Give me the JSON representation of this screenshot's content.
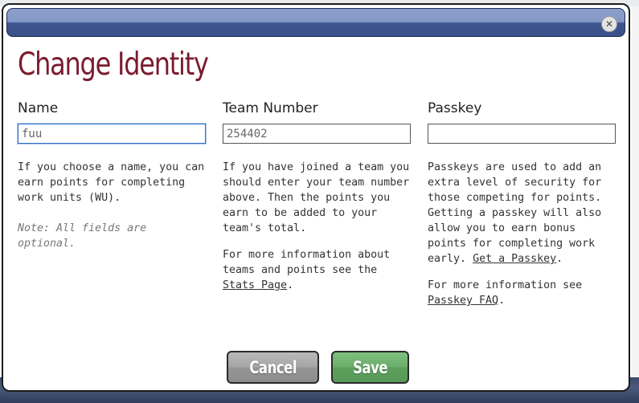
{
  "dialog": {
    "title": "Change Identity",
    "close_icon": "close-icon"
  },
  "name_column": {
    "label": "Name",
    "value": "fuu",
    "help": "If you choose a name, you can earn points for completing work units (WU).",
    "note": "Note: All fields are optional."
  },
  "team_column": {
    "label": "Team Number",
    "value": "254402",
    "help": "If you have joined a team you should enter your team number above. Then the points you earn to be added to your team's total.",
    "more_prefix": "For more information about teams and points see the ",
    "more_link": "Stats Page",
    "more_suffix": "."
  },
  "passkey_column": {
    "label": "Passkey",
    "value": "",
    "help": "Passkeys are used to add an extra level of security for those competing for points. Getting a passkey will also allow you to earn bonus points for completing work early.",
    "get_link": "Get a Passkey",
    "get_suffix": ".",
    "more_prefix": "For more information see ",
    "more_link": "Passkey FAQ",
    "more_suffix": "."
  },
  "buttons": {
    "cancel": "Cancel",
    "save": "Save"
  },
  "colors": {
    "title": "#7a1c2e",
    "titlebar": "#3c5490",
    "cancel": "#a0a0a0",
    "save": "#6aac6a"
  }
}
